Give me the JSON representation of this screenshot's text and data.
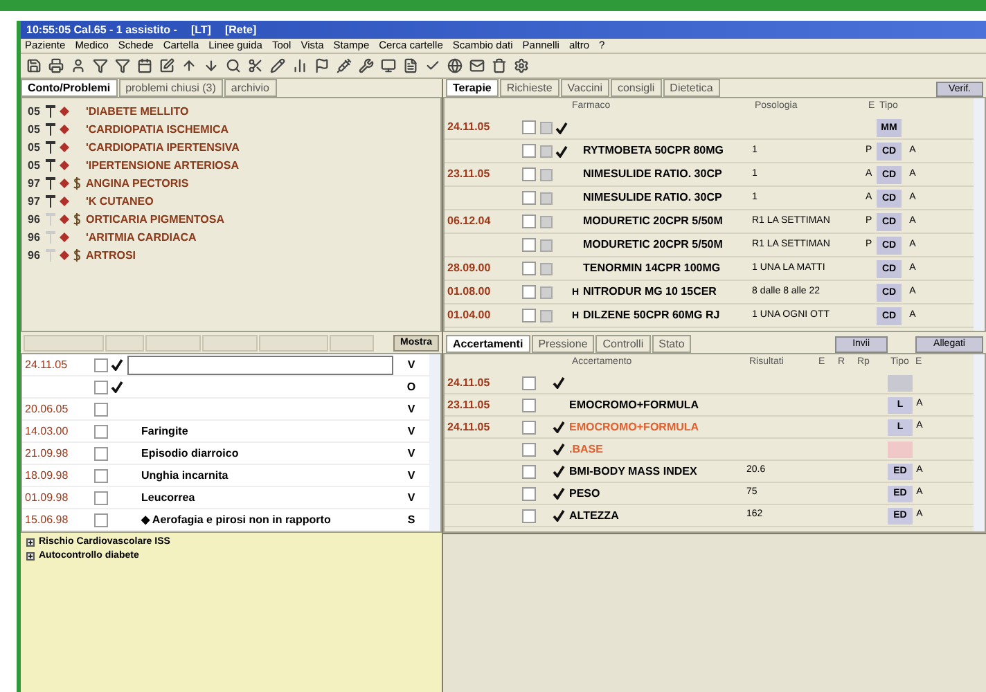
{
  "window": {
    "title": "10:55:05  Cal.65  - 1 assistito -",
    "tags": [
      "[LT]",
      "[Rete]"
    ]
  },
  "menu": [
    "Paziente",
    "Medico",
    "Schede",
    "Cartella",
    "Linee guida",
    "Tool",
    "Vista",
    "Stampe",
    "Cerca cartelle",
    "Scambio dati",
    "Pannelli",
    "altro",
    "?"
  ],
  "problems": {
    "tabs": [
      {
        "label": "Conto/Problemi",
        "selected": true
      },
      {
        "label": "problemi chiusi (3)",
        "selected": false
      },
      {
        "label": "archivio",
        "selected": false
      }
    ],
    "items": [
      {
        "year": "05",
        "flag": true,
        "marked": false,
        "text": "'DIABETE MELLITO"
      },
      {
        "year": "05",
        "flag": true,
        "marked": false,
        "text": "'CARDIOPATIA ISCHEMICA"
      },
      {
        "year": "05",
        "flag": true,
        "marked": false,
        "text": "'CARDIOPATIA IPERTENSIVA"
      },
      {
        "year": "05",
        "flag": true,
        "marked": false,
        "text": "'IPERTENSIONE ARTERIOSA"
      },
      {
        "year": "97",
        "flag": true,
        "marked": true,
        "text": "ANGINA PECTORIS"
      },
      {
        "year": "97",
        "flag": true,
        "marked": false,
        "text": "'K CUTANEO"
      },
      {
        "year": "96",
        "flag": false,
        "marked": true,
        "text": "ORTICARIA PIGMENTOSA"
      },
      {
        "year": "96",
        "flag": false,
        "marked": false,
        "text": "'ARITMIA CARDIACA"
      },
      {
        "year": "96",
        "flag": false,
        "marked": true,
        "text": "ARTROSI"
      }
    ]
  },
  "therapy": {
    "tabs": [
      {
        "label": "Terapie",
        "selected": true
      },
      {
        "label": "Richieste",
        "selected": false
      },
      {
        "label": "Vaccini",
        "selected": false
      },
      {
        "label": "consigli",
        "selected": false
      },
      {
        "label": "Dietetica",
        "selected": false
      }
    ],
    "button": "Verif.",
    "columns": [
      "Farmaco",
      "Posologia",
      "E",
      "Tipo"
    ],
    "rows": [
      {
        "date": "24.11.05",
        "checked": false,
        "ticked": true,
        "marker": "",
        "drug": "",
        "dose": "",
        "e": "",
        "type": "MM",
        "x": ""
      },
      {
        "date": "",
        "checked": false,
        "ticked": true,
        "marker": "",
        "drug": "RYTMOBETA 50CPR 80MG",
        "dose": "1",
        "e": "P",
        "type": "CD",
        "x": "A"
      },
      {
        "date": "23.11.05",
        "checked": false,
        "ticked": false,
        "marker": "",
        "drug": "NIMESULIDE RATIO. 30CP",
        "dose": "1",
        "e": "A",
        "type": "CD",
        "x": "A"
      },
      {
        "date": "",
        "checked": false,
        "ticked": false,
        "marker": "",
        "drug": "NIMESULIDE RATIO. 30CP",
        "dose": "1",
        "e": "A",
        "type": "CD",
        "x": "A"
      },
      {
        "date": "06.12.04",
        "checked": false,
        "ticked": false,
        "marker": "",
        "drug": "MODURETIC 20CPR 5/50M",
        "dose": "R1 LA SETTIMAN",
        "e": "P",
        "type": "CD",
        "x": "A"
      },
      {
        "date": "",
        "checked": false,
        "ticked": false,
        "marker": "",
        "drug": "MODURETIC 20CPR 5/50M",
        "dose": "R1 LA SETTIMAN",
        "e": "P",
        "type": "CD",
        "x": "A"
      },
      {
        "date": "28.09.00",
        "checked": false,
        "ticked": false,
        "marker": "",
        "drug": "TENORMIN 14CPR 100MG",
        "dose": "1 UNA LA MATTI",
        "e": "",
        "type": "CD",
        "x": "A"
      },
      {
        "date": "01.08.00",
        "checked": false,
        "ticked": false,
        "marker": "H",
        "drug": "NITRODUR MG 10 15CER",
        "dose": "8 dalle 8 alle 22",
        "e": "",
        "type": "CD",
        "x": "A"
      },
      {
        "date": "01.04.00",
        "checked": false,
        "ticked": false,
        "marker": "H",
        "drug": "DILZENE 50CPR 60MG RJ",
        "dose": "1 UNA OGNI OTT",
        "e": "",
        "type": "CD",
        "x": "A"
      }
    ]
  },
  "diary": {
    "show_button": "Mostra",
    "rows": [
      {
        "date": "24.11.05",
        "checked": false,
        "ticked": true,
        "editing": true,
        "text": "",
        "code": "V"
      },
      {
        "date": "",
        "checked": false,
        "ticked": true,
        "editing": false,
        "text": "",
        "code": "O"
      },
      {
        "date": "20.06.05",
        "checked": false,
        "ticked": false,
        "editing": false,
        "text": "",
        "code": "V"
      },
      {
        "date": "14.03.00",
        "checked": false,
        "ticked": false,
        "editing": false,
        "text": "Faringite",
        "code": "V"
      },
      {
        "date": "21.09.98",
        "checked": false,
        "ticked": false,
        "editing": false,
        "text": "Episodio diarroico",
        "code": "V"
      },
      {
        "date": "18.09.98",
        "checked": false,
        "ticked": false,
        "editing": false,
        "text": "Unghia incarnita",
        "code": "V"
      },
      {
        "date": "01.09.98",
        "checked": false,
        "ticked": false,
        "editing": false,
        "text": "Leucorrea",
        "code": "V"
      },
      {
        "date": "15.06.98",
        "checked": false,
        "ticked": false,
        "editing": false,
        "text": "◆ Aerofagia e pirosi non in rapporto",
        "code": "S"
      }
    ]
  },
  "guidelines": [
    "Rischio Cardiovascolare ISS",
    "Autocontrollo diabete"
  ],
  "exams": {
    "tabs": [
      {
        "label": "Accertamenti",
        "selected": true
      },
      {
        "label": "Pressione",
        "selected": false
      },
      {
        "label": "Controlli",
        "selected": false
      },
      {
        "label": "Stato",
        "selected": false
      }
    ],
    "buttons": [
      "Invii",
      "Allegati"
    ],
    "columns": [
      "Accertamento",
      "Risultati",
      "E",
      "R",
      "Rp",
      "Tipo",
      "E"
    ],
    "rows": [
      {
        "date": "24.11.05",
        "checked": false,
        "ticked": true,
        "name": "",
        "result": "",
        "type": "",
        "color": "#c8c8d0",
        "x": ""
      },
      {
        "date": "23.11.05",
        "checked": false,
        "ticked": false,
        "name": "EMOCROMO+FORMULA",
        "result": "",
        "pending": false,
        "type": "L",
        "color": "#c8c8e0",
        "x": "A"
      },
      {
        "date": "24.11.05",
        "checked": false,
        "ticked": true,
        "name": "EMOCROMO+FORMULA",
        "result": "",
        "pending": true,
        "type": "L",
        "color": "#c8c8e0",
        "x": "A"
      },
      {
        "date": "",
        "checked": false,
        "ticked": true,
        "name": ".BASE",
        "result": "",
        "pending": true,
        "type": "",
        "color": "#f0c8c8",
        "x": ""
      },
      {
        "date": "",
        "checked": false,
        "ticked": true,
        "name": "BMI-BODY MASS INDEX",
        "result": "20.6",
        "pending": false,
        "type": "ED",
        "color": "#c8c8e0",
        "x": "A"
      },
      {
        "date": "",
        "checked": false,
        "ticked": true,
        "name": "PESO",
        "result": "75",
        "pending": false,
        "type": "ED",
        "color": "#c8c8e0",
        "x": "A"
      },
      {
        "date": "",
        "checked": false,
        "ticked": true,
        "name": "ALTEZZA",
        "result": "162",
        "pending": false,
        "type": "ED",
        "color": "#c8c8e0",
        "x": "A"
      }
    ]
  }
}
